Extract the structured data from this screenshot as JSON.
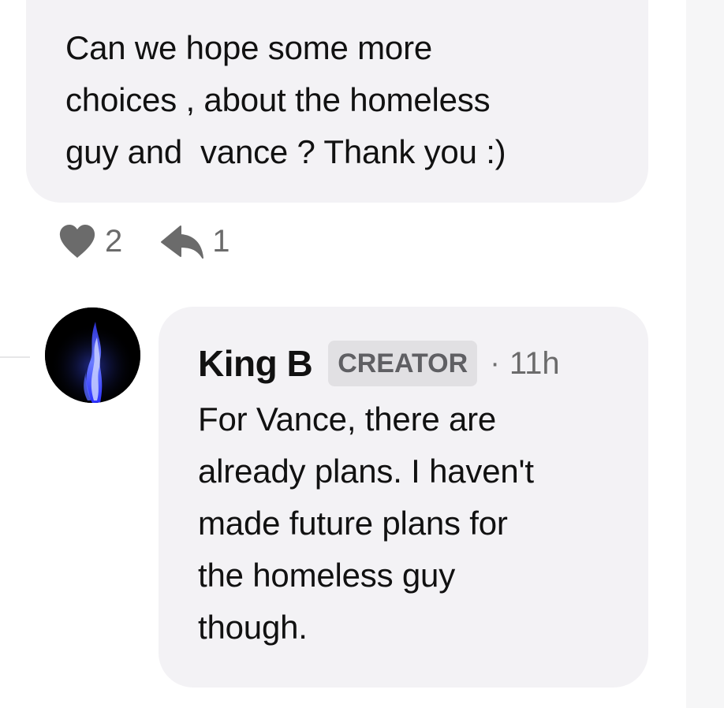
{
  "comment": {
    "text": "Can we hope some more\nchoices , about the homeless\nguy and  vance ? Thank you :)",
    "likes": "2",
    "replies": "1",
    "like_icon": "heart-icon",
    "reply_icon": "reply-arrow-icon"
  },
  "reply": {
    "author": "King B",
    "badge": "CREATOR",
    "separator": "·",
    "time": "11h",
    "text": "For Vance, there are\nalready plans. I haven't\nmade future plans for\nthe homeless guy\nthough.",
    "avatar_icon": "blue-flame-avatar"
  },
  "colors": {
    "bubble": "#f3f2f5",
    "badge_bg": "#e1e0e3",
    "muted_text": "#6b6b6b",
    "icon": "#6b6b6b",
    "flame": "#4a5cff"
  }
}
